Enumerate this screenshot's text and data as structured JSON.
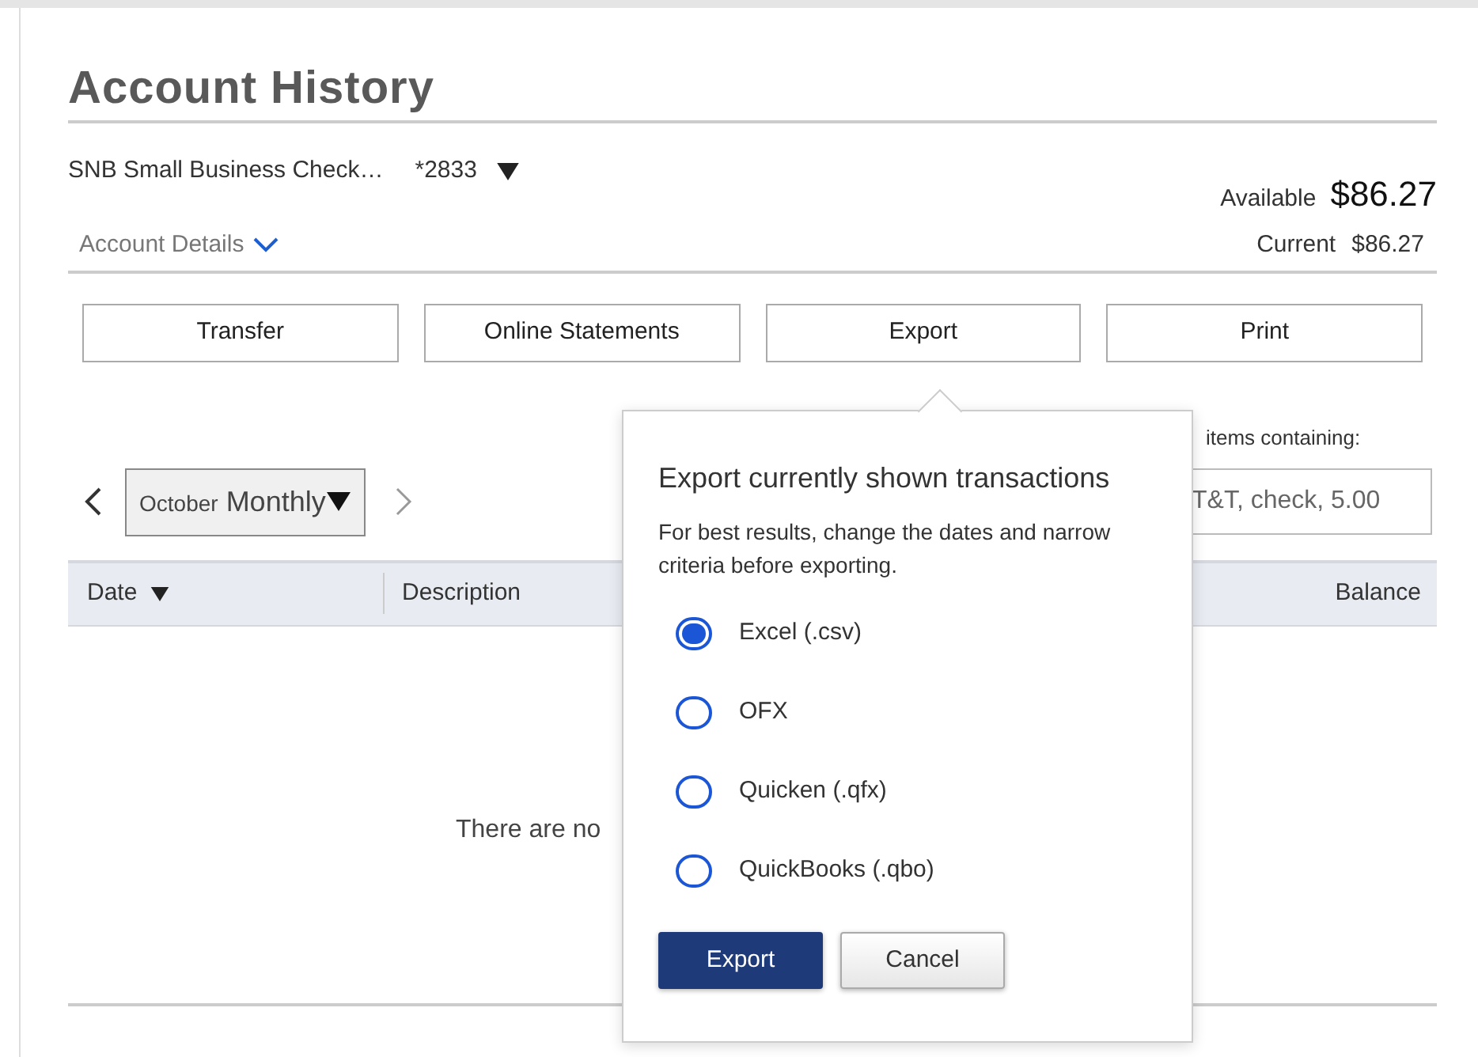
{
  "page": {
    "title": "Account History"
  },
  "account": {
    "name": "SNB Small Business Check…",
    "number": "*2833",
    "available_label": "Available",
    "available": "$86.27",
    "details_link": "Account Details",
    "current_label": "Current",
    "current": "$86.27"
  },
  "actions": [
    {
      "label": "Transfer"
    },
    {
      "label": "Online Statements"
    },
    {
      "label": "Export"
    },
    {
      "label": "Print"
    }
  ],
  "period": {
    "month": "October",
    "mode": "Monthly"
  },
  "filter": {
    "label": "items containing:",
    "placeholder": "T&T, check, 5.00"
  },
  "table": {
    "columns": [
      {
        "label": "Date",
        "sorted": true
      },
      {
        "label": "Description",
        "sorted": false
      },
      {
        "label": "Balance",
        "sorted": false
      }
    ],
    "empty_message": "There are no"
  },
  "export_popup": {
    "title": "Export currently shown transactions",
    "note": "For best results, change the dates and narrow criteria before exporting.",
    "options": [
      {
        "label": "Excel (.csv)",
        "selected": true
      },
      {
        "label": "OFX",
        "selected": false
      },
      {
        "label": "Quicken (.qfx)",
        "selected": false
      },
      {
        "label": "QuickBooks (.qbo)",
        "selected": false
      }
    ],
    "buttons": [
      {
        "label": "Export",
        "kind": "primary"
      },
      {
        "label": "Cancel",
        "kind": "secondary"
      }
    ]
  }
}
